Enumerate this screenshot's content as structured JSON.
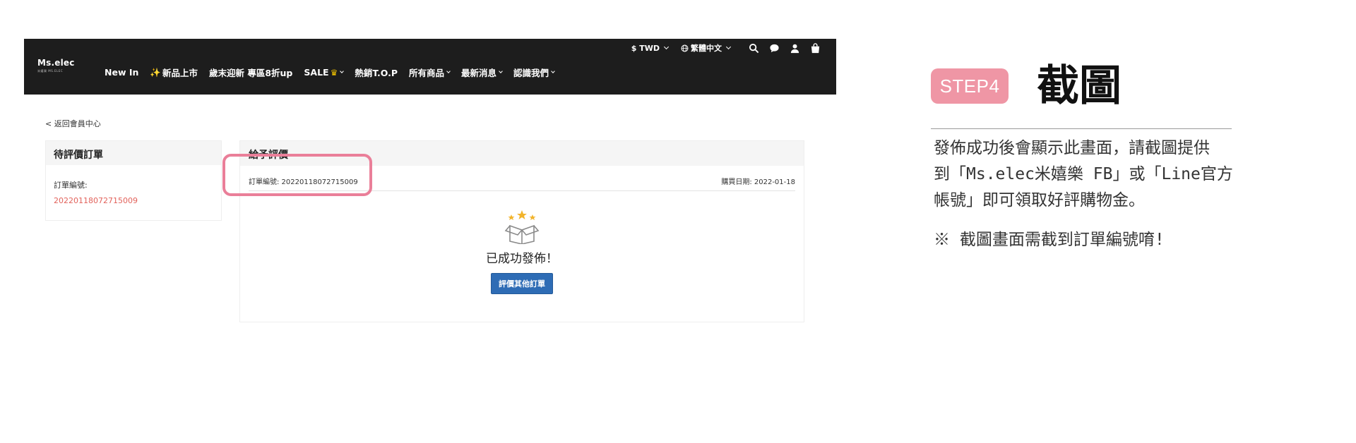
{
  "header": {
    "logo": "Ms.elec",
    "logo_sub": "米嬉樂 MS.ELEC",
    "currency": "$ TWD",
    "language": "繁體中文"
  },
  "icons": [
    "globe-icon",
    "search-icon",
    "chat-icon",
    "user-icon",
    "shopping-bag-icon",
    "gift-box-icon"
  ],
  "nav": {
    "new_in": "New In",
    "new_products": "新品上市",
    "year_end": "歲末迎新 專區8折up",
    "sale": "SALE",
    "hot": "熱銷T.O.P",
    "all_products": "所有商品",
    "news": "最新消息",
    "about": "認識我們"
  },
  "page": {
    "back_link": "< 返回會員中心",
    "pending_title": "待評價訂單",
    "order_no_label": "訂單編號:",
    "order_no": "20220118072715009",
    "review_title": "給予評價",
    "order_line": "訂單編號: 20220118072715009",
    "purchase_date": "購買日期: 2022-01-18",
    "success_text": "已成功發佈！",
    "review_other_button": "評價其他訂單"
  },
  "instructions": {
    "step_label": "STEP4",
    "title": "截圖",
    "desc_line1": "發佈成功後會顯示此畫面，請截圖提供",
    "desc_line2": "到「Ms.elec米嬉樂 FB」或「Line官方",
    "desc_line3": "帳號」即可領取好評購物金。",
    "note": "※ 截圖畫面需截到訂單編號唷!"
  },
  "colors": {
    "accent_pink": "#ef96a5",
    "highlight_pink": "#ea7f99",
    "order_red": "#e2625b",
    "button_blue": "#2e6cb5",
    "topbar": "#1d1d1d"
  }
}
